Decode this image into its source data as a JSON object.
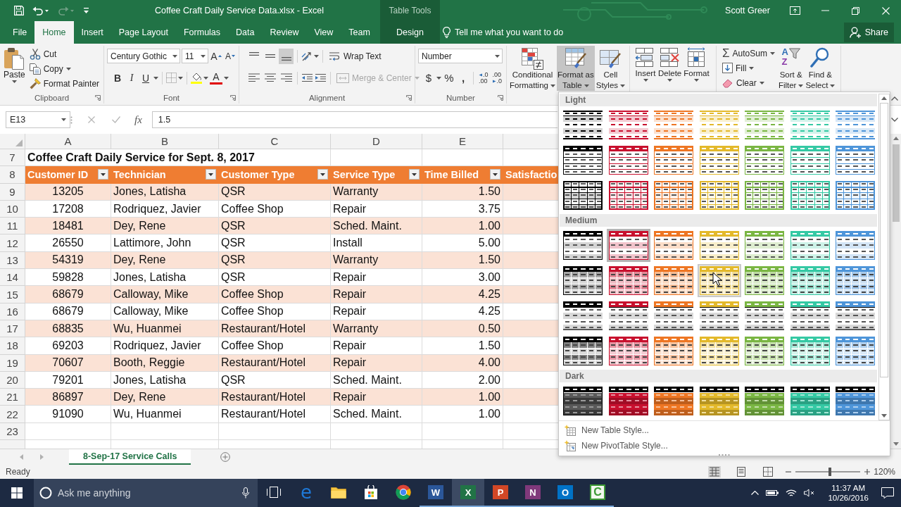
{
  "title_bar": {
    "quick_access": [
      {
        "kind": "save",
        "disabled": false
      },
      {
        "kind": "undo",
        "disabled": false
      },
      {
        "kind": "redo",
        "disabled": true
      },
      {
        "kind": "customize",
        "disabled": false
      }
    ],
    "title": "Coffee Craft Daily Service Data.xlsx - Excel",
    "context_group": "Table Tools",
    "user": "Scott Greer"
  },
  "tabs": [
    {
      "label": "File",
      "selected": false,
      "contextual": false
    },
    {
      "label": "Home",
      "selected": true,
      "contextual": false
    },
    {
      "label": "Insert",
      "selected": false,
      "contextual": false
    },
    {
      "label": "Page Layout",
      "selected": false,
      "contextual": false
    },
    {
      "label": "Formulas",
      "selected": false,
      "contextual": false
    },
    {
      "label": "Data",
      "selected": false,
      "contextual": false
    },
    {
      "label": "Review",
      "selected": false,
      "contextual": false
    },
    {
      "label": "View",
      "selected": false,
      "contextual": false
    },
    {
      "label": "Team",
      "selected": false,
      "contextual": false
    },
    {
      "label": "Design",
      "selected": false,
      "contextual": true
    }
  ],
  "tell_me": {
    "placeholder": "Tell me what you want to do"
  },
  "share": {
    "label": "Share"
  },
  "ribbon": {
    "clipboard": {
      "label": "Clipboard",
      "paste": "Paste",
      "commands": [
        {
          "label": "Cut",
          "dropdown": false
        },
        {
          "label": "Copy",
          "dropdown": true
        },
        {
          "label": "Format Painter",
          "dropdown": false
        }
      ]
    },
    "font": {
      "label": "Font",
      "font_name": "Century Gothic",
      "font_size": "11",
      "grow": "A",
      "shrink": "A",
      "emphasis": [
        "B",
        "I",
        "U"
      ],
      "font_color": "A"
    },
    "alignment": {
      "label": "Alignment",
      "vertical": [
        {
          "selected": false
        },
        {
          "selected": false
        },
        {
          "selected": true
        }
      ],
      "wrap_text": "Wrap Text",
      "merge": {
        "label": "Merge & Center",
        "disabled": true
      }
    },
    "number": {
      "label": "Number",
      "format": "Number",
      "currency": "$",
      "percent": "%",
      "comma": ",",
      "decimals": [
        {
          "top": ".0",
          "bottom": ".00"
        },
        {
          "top": ".00",
          "bottom": ".0"
        }
      ]
    },
    "styles": {
      "commands": [
        {
          "lines": [
            "Conditional",
            "Formatting"
          ],
          "pressed": false
        },
        {
          "lines": [
            "Format as",
            "Table"
          ],
          "pressed": true
        },
        {
          "lines": [
            "Cell",
            "Styles"
          ],
          "pressed": false
        }
      ]
    },
    "cells": {
      "commands": [
        "Insert",
        "Delete",
        "Format"
      ]
    },
    "editing": {
      "autosum": {
        "symbol": "Σ",
        "label": "AutoSum"
      },
      "fill": "Fill",
      "clear": "Clear",
      "sort_letters": [
        "A",
        "Z"
      ],
      "commands": [
        {
          "lines": [
            "Sort &",
            "Filter"
          ]
        },
        {
          "lines": [
            "Find &",
            "Select"
          ]
        }
      ]
    }
  },
  "formula_bar": {
    "name_box": "E13",
    "function_label": "fx",
    "value": "1.5"
  },
  "sheet": {
    "columns": [
      "A",
      "B",
      "C",
      "D",
      "E"
    ],
    "rows": [
      {
        "number": "7",
        "kind": "title",
        "cells": [
          "Coffee Craft Daily Service for Sept. 8, 2017"
        ]
      },
      {
        "number": "8",
        "kind": "header",
        "headers": [
          {
            "label": "Customer ID",
            "filter": true
          },
          {
            "label": "Technician",
            "filter": true
          },
          {
            "label": "Customer Type",
            "filter": true
          },
          {
            "label": "Service Type",
            "filter": true
          },
          {
            "label": "Time Billed",
            "filter": true
          },
          {
            "label": "Satisfactio"
          }
        ]
      },
      {
        "number": "9",
        "kind": "data",
        "banded": true,
        "cells": [
          "13205",
          "Jones, Latisha",
          "QSR",
          "Warranty",
          "1.50"
        ]
      },
      {
        "number": "10",
        "kind": "data",
        "banded": false,
        "cells": [
          "17208",
          "Rodriquez, Javier",
          "Coffee Shop",
          "Repair",
          "3.75"
        ]
      },
      {
        "number": "11",
        "kind": "data",
        "banded": true,
        "cells": [
          "18481",
          "Dey, Rene",
          "QSR",
          "Sched. Maint.",
          "1.00"
        ]
      },
      {
        "number": "12",
        "kind": "data",
        "banded": false,
        "cells": [
          "26550",
          "Lattimore, John",
          "QSR",
          "Install",
          "5.00"
        ]
      },
      {
        "number": "13",
        "kind": "data",
        "banded": true,
        "cells": [
          "54319",
          "Dey, Rene",
          "QSR",
          "Warranty",
          "1.50"
        ]
      },
      {
        "number": "14",
        "kind": "data",
        "banded": false,
        "cells": [
          "59828",
          "Jones, Latisha",
          "QSR",
          "Repair",
          "3.00"
        ]
      },
      {
        "number": "15",
        "kind": "data",
        "banded": true,
        "cells": [
          "68679",
          "Calloway, Mike",
          "Coffee Shop",
          "Repair",
          "4.25"
        ]
      },
      {
        "number": "16",
        "kind": "data",
        "banded": false,
        "cells": [
          "68679",
          "Calloway, Mike",
          "Coffee Shop",
          "Repair",
          "4.25"
        ]
      },
      {
        "number": "17",
        "kind": "data",
        "banded": true,
        "cells": [
          "68835",
          "Wu, Huanmei",
          "Restaurant/Hotel",
          "Warranty",
          "0.50"
        ]
      },
      {
        "number": "18",
        "kind": "data",
        "banded": false,
        "cells": [
          "69203",
          "Rodriquez, Javier",
          "Coffee Shop",
          "Repair",
          "1.50"
        ]
      },
      {
        "number": "19",
        "kind": "data",
        "banded": true,
        "cells": [
          "70607",
          "Booth, Reggie",
          "Restaurant/Hotel",
          "Repair",
          "4.00"
        ]
      },
      {
        "number": "20",
        "kind": "data",
        "banded": false,
        "cells": [
          "79201",
          "Jones, Latisha",
          "QSR",
          "Sched. Maint.",
          "2.00"
        ]
      },
      {
        "number": "21",
        "kind": "data",
        "banded": true,
        "cells": [
          "86897",
          "Dey, Rene",
          "Restaurant/Hotel",
          "Repair",
          "1.00"
        ]
      },
      {
        "number": "22",
        "kind": "data",
        "banded": false,
        "cells": [
          "91090",
          "Wu, Huanmei",
          "Restaurant/Hotel",
          "Sched. Maint.",
          "1.00"
        ]
      },
      {
        "number": "23",
        "kind": "empty"
      }
    ]
  },
  "gallery": {
    "sections": [
      {
        "title": "Light",
        "rows": [
          {
            "kind": "light-banded",
            "styles": [
              {
                "color": "#000000",
                "selected": false,
                "hovered": false
              },
              {
                "color": "#c8102e",
                "selected": false,
                "hovered": false
              },
              {
                "color": "#ee7623",
                "selected": false,
                "hovered": false
              },
              {
                "color": "#e3b92b",
                "selected": false,
                "hovered": false
              },
              {
                "color": "#7ab643",
                "selected": false,
                "hovered": false
              },
              {
                "color": "#35c9a4",
                "selected": false,
                "hovered": false
              },
              {
                "color": "#4e95d9",
                "selected": false,
                "hovered": false
              }
            ]
          },
          {
            "kind": "light-header",
            "styles": [
              {
                "color": "#000000",
                "selected": false,
                "hovered": false
              },
              {
                "color": "#c8102e",
                "selected": false,
                "hovered": false
              },
              {
                "color": "#ee7623",
                "selected": false,
                "hovered": false
              },
              {
                "color": "#e3b92b",
                "selected": false,
                "hovered": false
              },
              {
                "color": "#7ab643",
                "selected": false,
                "hovered": false
              },
              {
                "color": "#35c9a4",
                "selected": false,
                "hovered": false
              },
              {
                "color": "#4e95d9",
                "selected": false,
                "hovered": false
              }
            ]
          },
          {
            "kind": "light-grid",
            "styles": [
              {
                "color": "#000000",
                "selected": false,
                "hovered": false
              },
              {
                "color": "#c8102e",
                "selected": false,
                "hovered": false
              },
              {
                "color": "#ee7623",
                "selected": false,
                "hovered": false
              },
              {
                "color": "#e3b92b",
                "selected": false,
                "hovered": false
              },
              {
                "color": "#7ab643",
                "selected": false,
                "hovered": false
              },
              {
                "color": "#35c9a4",
                "selected": false,
                "hovered": false
              },
              {
                "color": "#4e95d9",
                "selected": false,
                "hovered": false
              }
            ]
          }
        ]
      },
      {
        "title": "Medium",
        "rows": [
          {
            "kind": "medium-banded",
            "styles": [
              {
                "color": "#000000",
                "selected": false,
                "hovered": false
              },
              {
                "color": "#c8102e",
                "selected": true,
                "hovered": false
              },
              {
                "color": "#ee7623",
                "selected": false,
                "hovered": false
              },
              {
                "color": "#e3b92b",
                "selected": false,
                "hovered": false
              },
              {
                "color": "#7ab643",
                "selected": false,
                "hovered": false
              },
              {
                "color": "#35c9a4",
                "selected": false,
                "hovered": false
              },
              {
                "color": "#4e95d9",
                "selected": false,
                "hovered": false
              }
            ]
          },
          {
            "kind": "medium-header-grid",
            "styles": [
              {
                "color": "#000000",
                "selected": false,
                "hovered": false
              },
              {
                "color": "#c8102e",
                "selected": false,
                "hovered": false
              },
              {
                "color": "#ee7623",
                "selected": false,
                "hovered": false
              },
              {
                "color": "#e3b92b",
                "selected": false,
                "hovered": true
              },
              {
                "color": "#7ab643",
                "selected": false,
                "hovered": false
              },
              {
                "color": "#35c9a4",
                "selected": false,
                "hovered": false
              },
              {
                "color": "#4e95d9",
                "selected": false,
                "hovered": false
              }
            ]
          },
          {
            "kind": "medium-ruled",
            "styles": [
              {
                "color": "#000000",
                "selected": false,
                "hovered": false
              },
              {
                "color": "#c8102e",
                "selected": false,
                "hovered": false
              },
              {
                "color": "#ee7623",
                "selected": false,
                "hovered": false
              },
              {
                "color": "#e3b92b",
                "selected": false,
                "hovered": false
              },
              {
                "color": "#7ab643",
                "selected": false,
                "hovered": false
              },
              {
                "color": "#35c9a4",
                "selected": false,
                "hovered": false
              },
              {
                "color": "#4e95d9",
                "selected": false,
                "hovered": false
              }
            ]
          },
          {
            "kind": "medium-tinted-grid",
            "styles": [
              {
                "color": "#000000",
                "selected": false,
                "hovered": false
              },
              {
                "color": "#c8102e",
                "selected": false,
                "hovered": false
              },
              {
                "color": "#ee7623",
                "selected": false,
                "hovered": false
              },
              {
                "color": "#e3b92b",
                "selected": false,
                "hovered": false
              },
              {
                "color": "#7ab643",
                "selected": false,
                "hovered": false
              },
              {
                "color": "#35c9a4",
                "selected": false,
                "hovered": false
              },
              {
                "color": "#4e95d9",
                "selected": false,
                "hovered": false
              }
            ]
          }
        ]
      },
      {
        "title": "Dark",
        "rows": [
          {
            "kind": "dark",
            "styles": [
              {
                "color": "#000000",
                "selected": false,
                "hovered": false
              },
              {
                "color": "#c8102e",
                "selected": false,
                "hovered": false
              },
              {
                "color": "#ee7623",
                "selected": false,
                "hovered": false
              },
              {
                "color": "#e3b92b",
                "selected": false,
                "hovered": false
              },
              {
                "color": "#7ab643",
                "selected": false,
                "hovered": false
              },
              {
                "color": "#35c9a4",
                "selected": false,
                "hovered": false
              },
              {
                "color": "#4e95d9",
                "selected": false,
                "hovered": false
              }
            ]
          }
        ]
      }
    ],
    "menu": [
      {
        "label": "New Table Style..."
      },
      {
        "label": "New PivotTable Style..."
      }
    ]
  },
  "sheet_tabs": [
    {
      "label": "8-Sep-17 Service Calls",
      "selected": true
    }
  ],
  "status_bar": {
    "status": "Ready",
    "views": [
      {
        "selected": true
      },
      {
        "selected": false
      },
      {
        "selected": false
      }
    ],
    "zoom": {
      "level": 0.53,
      "reading": "120%"
    }
  },
  "taskbar": {
    "search": {
      "placeholder": "Ask me anything"
    },
    "apps": [
      {
        "kind": "task-view",
        "running": false,
        "active": false
      },
      {
        "kind": "letter-logo",
        "glyph": "e",
        "color": "#1e78d7",
        "running": false,
        "active": false
      },
      {
        "kind": "folder",
        "running": false,
        "active": false
      },
      {
        "kind": "bag",
        "running": false,
        "active": false
      },
      {
        "kind": "round-logo",
        "running": false,
        "active": false
      },
      {
        "kind": "tile",
        "glyph": "W",
        "color": "#2b579a",
        "running": true,
        "active": false
      },
      {
        "kind": "tile",
        "glyph": "X",
        "color": "#217346",
        "running": true,
        "active": true
      },
      {
        "kind": "tile",
        "glyph": "P",
        "color": "#d24726",
        "running": true,
        "active": false
      },
      {
        "kind": "tile",
        "glyph": "N",
        "color": "#80397b",
        "running": true,
        "active": false
      },
      {
        "kind": "tile",
        "glyph": "O",
        "color": "#0072c6",
        "running": true,
        "active": false
      },
      {
        "kind": "outline-tile",
        "glyph": "C",
        "color": "#3d9a35",
        "running": true,
        "active": false
      }
    ],
    "time": "11:37 AM",
    "date": "10/26/2016"
  }
}
